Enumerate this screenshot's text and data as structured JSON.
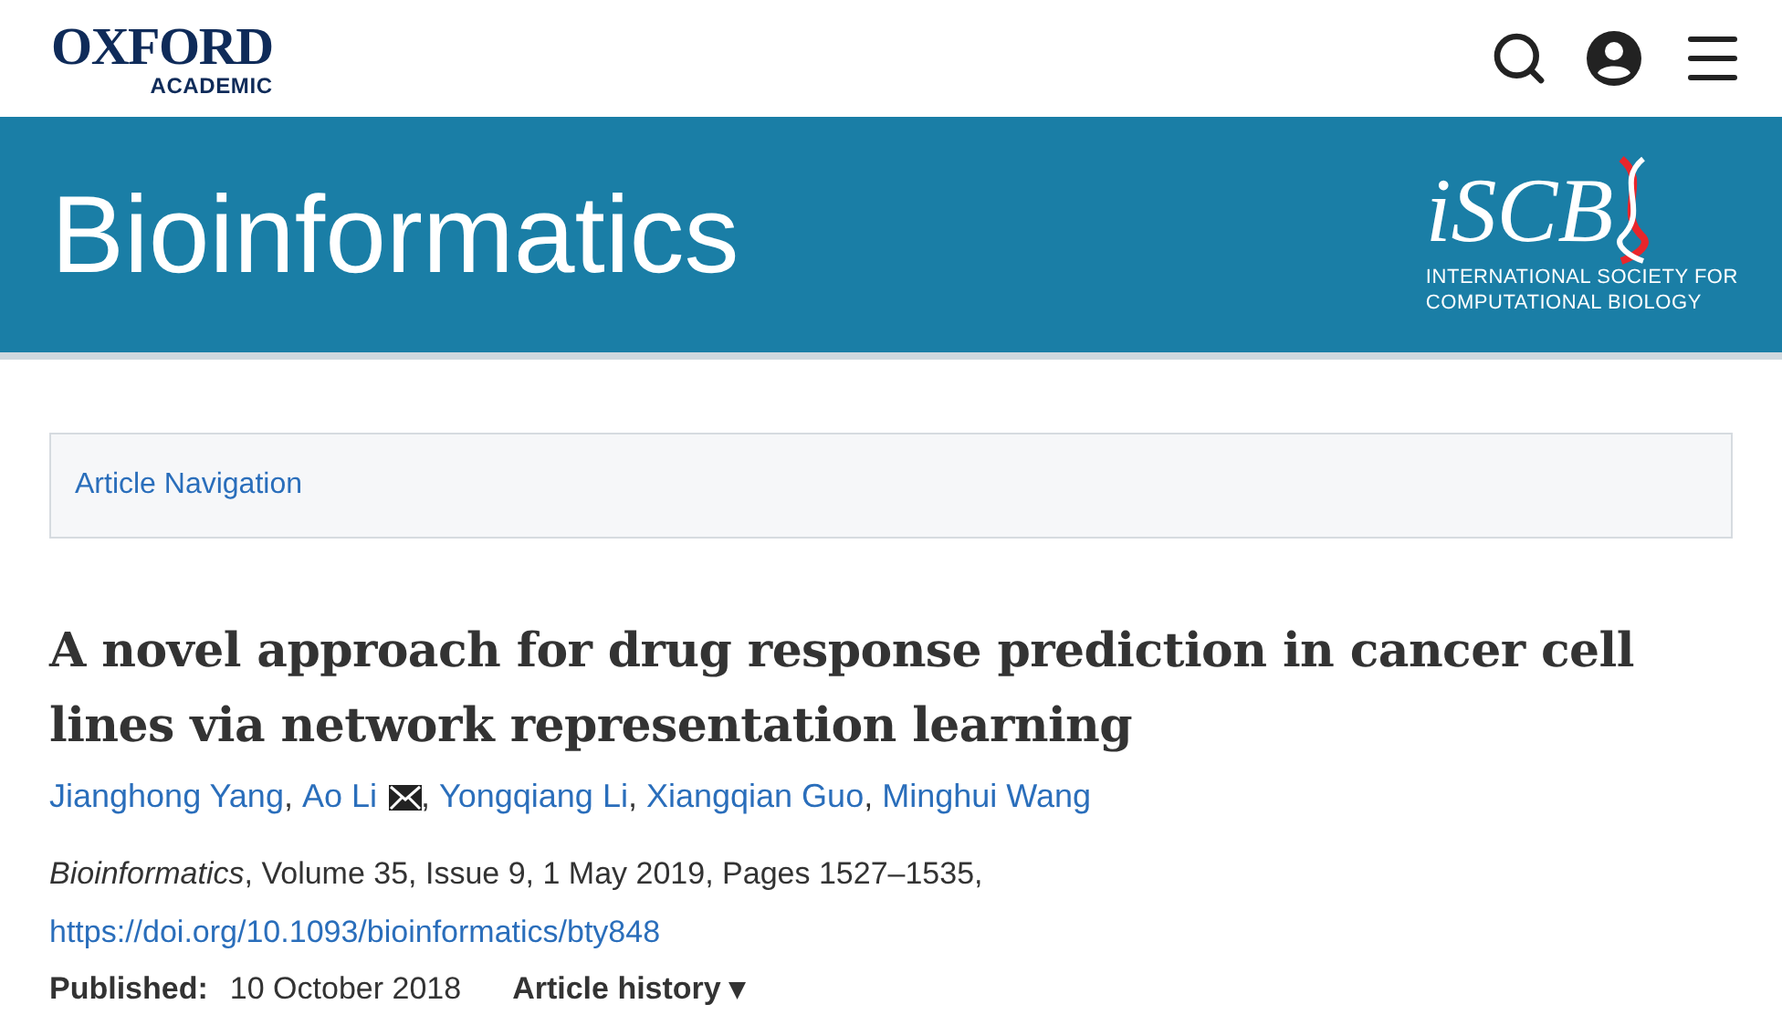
{
  "header": {
    "publisher": "OXFORD",
    "publisher_sub": "ACADEMIC"
  },
  "banner": {
    "journal": "Bioinformatics",
    "society_logo": "iSCB",
    "society_name": [
      "INTERNATIONAL SOCIETY FOR",
      "COMPUTATIONAL BIOLOGY"
    ]
  },
  "article_navigation": {
    "label": "Article Navigation"
  },
  "article": {
    "title": "A novel approach for drug response prediction in cancer cell lines via network representation learning",
    "authors": [
      {
        "name": "Jianghong Yang",
        "corresponding": false,
        "separator": ","
      },
      {
        "name": "Ao Li",
        "corresponding": true,
        "separator": ","
      },
      {
        "name": "Yongqiang Li",
        "corresponding": false,
        "separator": ","
      },
      {
        "name": "Xiangqian Guo",
        "corresponding": false,
        "separator": ","
      },
      {
        "name": "Minghui Wang",
        "corresponding": false
      }
    ],
    "citation": "*Bioinformatics*, Volume 35, Issue 9, 1 May 2019, Pages 1527–1535,",
    "doi": "https://doi.org/10.1093/bioinformatics/bty848",
    "published_label": "Published:",
    "published_date": "10 October 2018",
    "history": "Article history ▾"
  }
}
